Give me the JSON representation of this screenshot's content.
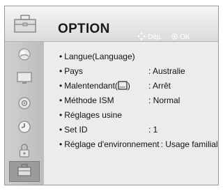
{
  "header": {
    "title": "OPTION",
    "nav_hint": "Dép.",
    "ok_hint": "OK"
  },
  "sidebar": {
    "items": [
      {
        "icon": "picture-icon"
      },
      {
        "icon": "screen-icon"
      },
      {
        "icon": "audio-icon"
      },
      {
        "icon": "clock-icon"
      },
      {
        "icon": "lock-icon"
      },
      {
        "icon": "option-icon",
        "active": true
      }
    ]
  },
  "menu": {
    "bullet": "•",
    "items": [
      {
        "label": "Langue(Language)",
        "value": ""
      },
      {
        "label": "Pays",
        "value": ": Australie"
      },
      {
        "label": "Malentendant(",
        "label_suffix": ")",
        "value": ": Arrêt"
      },
      {
        "label": "Méthode ISM",
        "value": ": Normal"
      },
      {
        "label": "Réglages usine",
        "value": ""
      },
      {
        "label": "Set ID",
        "value": ": 1"
      },
      {
        "label": "Réglage d'environnement",
        "value": ": Usage familial"
      }
    ]
  }
}
